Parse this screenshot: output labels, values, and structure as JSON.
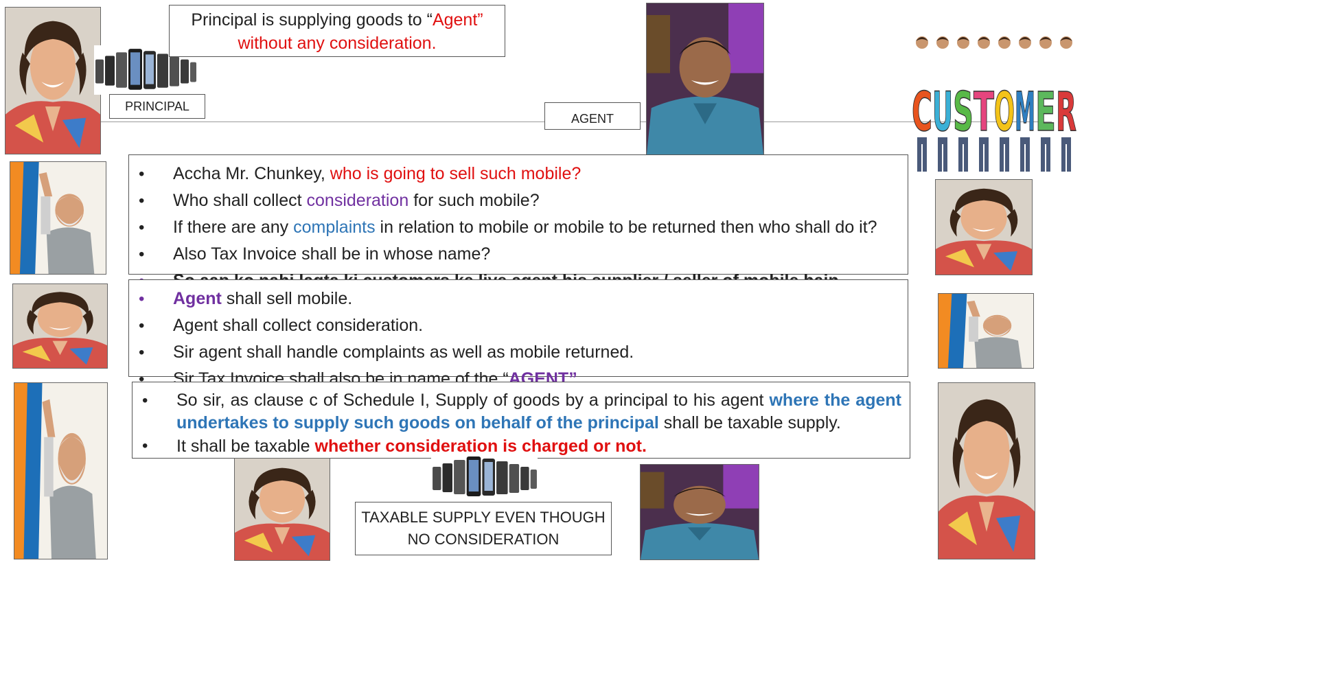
{
  "top_note": {
    "prefix": "Principal is supplying goods to “",
    "agent_word": "Agent”",
    "line2": "without any consideration."
  },
  "labels": {
    "principal": "PRINCIPAL",
    "agent": "AGENT"
  },
  "customer_banner": {
    "letters": [
      "C",
      "U",
      "S",
      "T",
      "O",
      "M",
      "E",
      "R"
    ],
    "colors": [
      "#e8541e",
      "#3bb0d6",
      "#58b947",
      "#e5457e",
      "#f3c319",
      "#2f7fc1",
      "#5cb85c",
      "#d93a3a"
    ]
  },
  "box1": {
    "l1_plain": "Accha Mr. Chunkey, ",
    "l1_red": "who is going to sell such mobile?",
    "l2_plain": "Who shall collect ",
    "l2_purple": "consideration",
    "l2_end": " for such mobile?",
    "l3_plain": "If there are any ",
    "l3_blue": "complaints",
    "l3_end": " in relation to mobile or mobile to be returned then who shall do it?",
    "l4": "Also Tax Invoice shall be in whose name?",
    "l5": "So aap ko nahi lagta ki customers ke liye agent his supplier / seller of mobile hain."
  },
  "box2": {
    "l1_bold": "Agent",
    "l1_end": " shall sell mobile.",
    "l2": "Agent shall collect consideration.",
    "l3": "Sir agent shall handle complaints as well as mobile returned.",
    "l4_plain": "Sir Tax Invoice shall also be in name of the “",
    "l4_bold": "AGENT”",
    "l4_end": "."
  },
  "box3": {
    "l1_plain": "So sir, as clause c of Schedule I, Supply of goods by a principal to his agent ",
    "l1_blue": "where the agent undertakes to supply such goods on behalf of the principal",
    "l1_end": " shall be taxable supply.",
    "l2_plain": "It shall be taxable ",
    "l2_red": "whether consideration is charged or not."
  },
  "bottom_note": {
    "line1": "TAXABLE SUPPLY EVEN THOUGH",
    "line2": "NO CONSIDERATION"
  }
}
